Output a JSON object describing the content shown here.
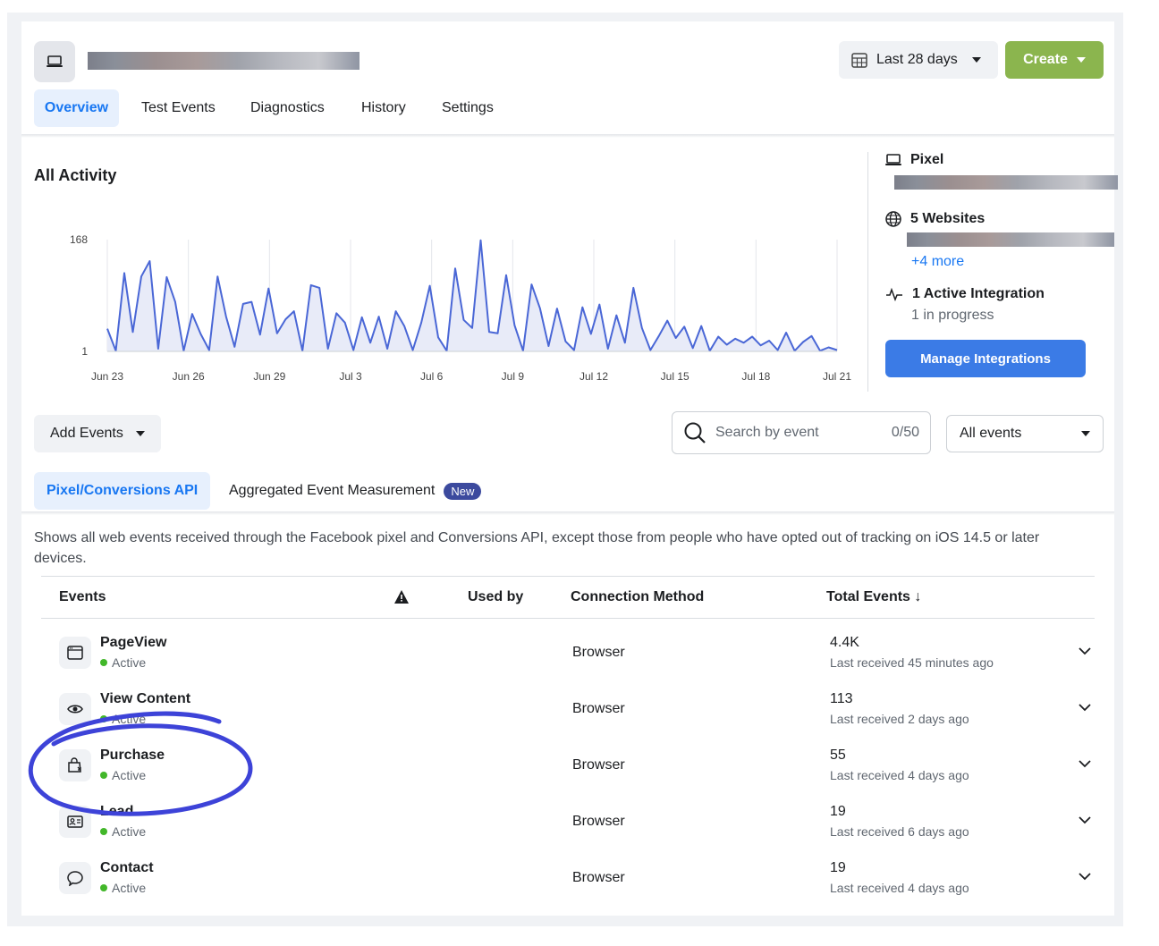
{
  "header": {
    "date_range_label": "Last 28 days",
    "create_label": "Create",
    "tabs": [
      "Overview",
      "Test Events",
      "Diagnostics",
      "History",
      "Settings"
    ],
    "active_tab": "Overview"
  },
  "activity": {
    "title": "All Activity",
    "chart_data": {
      "type": "area",
      "y_ticks": [
        "168",
        "1"
      ],
      "ylim": [
        1,
        168
      ],
      "x_ticks": [
        "Jun 23",
        "Jun 26",
        "Jun 29",
        "Jul 3",
        "Jul 6",
        "Jul 9",
        "Jul 12",
        "Jul 15",
        "Jul 18",
        "Jul 21"
      ],
      "values": [
        35,
        2,
        118,
        30,
        113,
        136,
        5,
        112,
        75,
        2,
        57,
        27,
        3,
        113,
        53,
        8,
        72,
        75,
        26,
        95,
        28,
        49,
        61,
        2,
        100,
        96,
        5,
        58,
        44,
        3,
        52,
        14,
        53,
        5,
        61,
        39,
        3,
        44,
        99,
        22,
        2,
        125,
        48,
        36,
        167,
        30,
        28,
        115,
        40,
        2,
        101,
        65,
        9,
        65,
        16,
        3,
        67,
        27,
        71,
        5,
        55,
        14,
        96,
        36,
        3,
        24,
        47,
        21,
        38,
        6,
        39,
        2,
        23,
        11,
        20,
        14,
        23,
        10,
        17,
        3,
        29,
        2,
        15,
        24,
        2,
        7,
        3
      ],
      "color": "#4a67d6"
    }
  },
  "panel": {
    "pixel_label": "Pixel",
    "websites_label": "5 Websites",
    "more_label": "+4 more",
    "integration_label": "1 Active Integration",
    "integration_sub": "1 in progress",
    "manage_label": "Manage Integrations"
  },
  "controls": {
    "add_events_label": "Add Events",
    "search_placeholder": "Search by event",
    "search_count": "0/50",
    "filter_label": "All events"
  },
  "subtabs": {
    "pixel_label": "Pixel/Conversions API",
    "aem_label": "Aggregated Event Measurement",
    "new_badge": "New"
  },
  "description": "Shows all web events received through the Facebook pixel and Conversions API, except those from people who have opted out of tracking on iOS 14.5 or later devices.",
  "table": {
    "headers": {
      "events": "Events",
      "used_by": "Used by",
      "connection": "Connection Method",
      "total": "Total Events ↓"
    },
    "rows": [
      {
        "name": "PageView",
        "status": "Active",
        "connection": "Browser",
        "total": "4.4K",
        "last": "Last received 45 minutes ago",
        "icon": "browser-window-icon"
      },
      {
        "name": "View Content",
        "status": "Active",
        "connection": "Browser",
        "total": "113",
        "last": "Last received 2 days ago",
        "icon": "eye-icon"
      },
      {
        "name": "Purchase",
        "status": "Active",
        "connection": "Browser",
        "total": "55",
        "last": "Last received 4 days ago",
        "icon": "shopping-bag-icon"
      },
      {
        "name": "Lead",
        "status": "Active",
        "connection": "Browser",
        "total": "19",
        "last": "Last received 6 days ago",
        "icon": "id-card-icon"
      },
      {
        "name": "Contact",
        "status": "Active",
        "connection": "Browser",
        "total": "19",
        "last": "Last received 4 days ago",
        "icon": "speech-bubble-icon"
      }
    ]
  }
}
